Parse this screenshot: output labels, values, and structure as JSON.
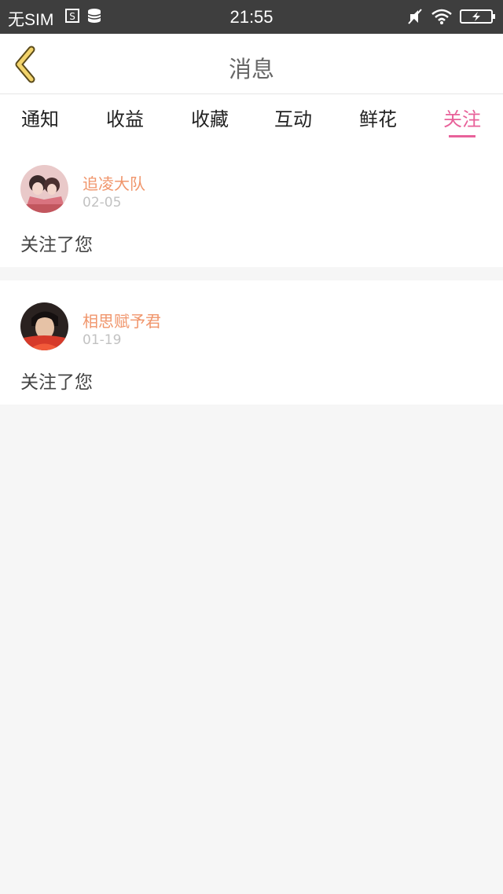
{
  "status_bar": {
    "carrier": "无SIM",
    "time": "21:55",
    "left_icons": [
      "s-box-icon",
      "storage-icon"
    ],
    "right_icons": [
      "mute-icon",
      "wifi-icon",
      "battery-charging-icon"
    ]
  },
  "header": {
    "back_icon": "chevron-left-icon",
    "title": "消息"
  },
  "tabs": {
    "items": [
      {
        "label": "通知"
      },
      {
        "label": "收益"
      },
      {
        "label": "收藏"
      },
      {
        "label": "互动"
      },
      {
        "label": "鲜花"
      },
      {
        "label": "关注"
      }
    ],
    "active": "关注"
  },
  "messages": [
    {
      "username": "追凌大队",
      "date": "02-05",
      "text": "关注了您"
    },
    {
      "username": "相思赋予君",
      "date": "01-19",
      "text": "关注了您"
    }
  ],
  "colors": {
    "accent": "#e8629a",
    "username": "#f0956b",
    "date": "#c2c2c2",
    "background": "#f6f6f6",
    "status_bar": "#3e3e3e"
  }
}
